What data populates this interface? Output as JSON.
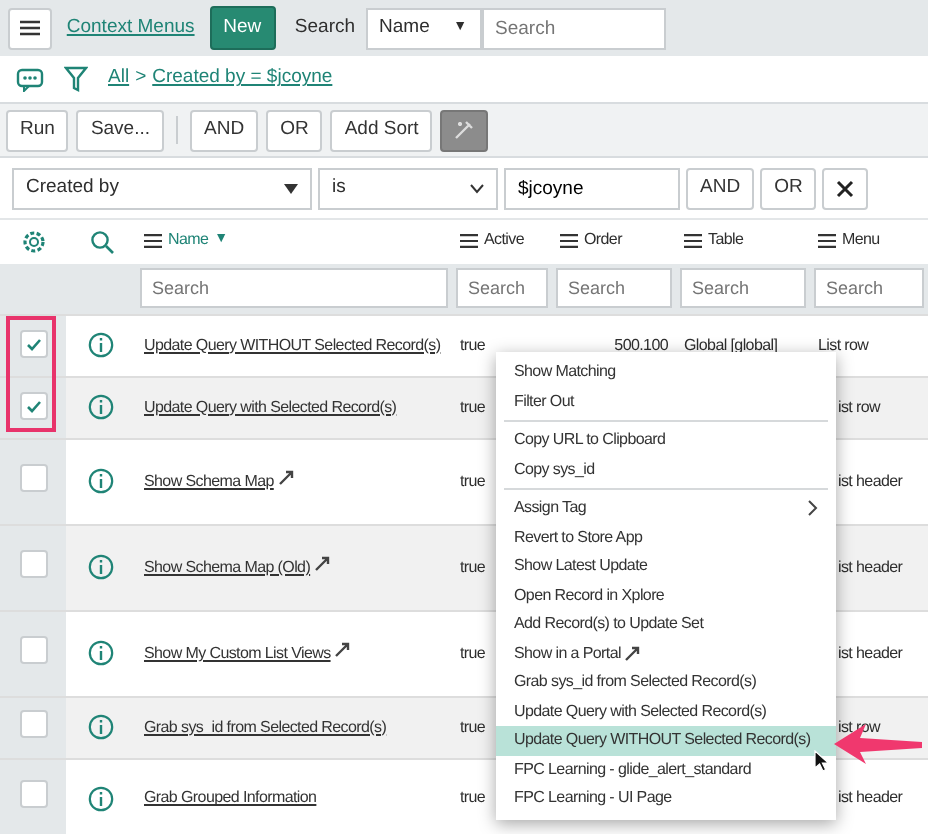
{
  "header": {
    "title": "Context Menus",
    "new_button": "New",
    "search_label": "Search",
    "search_field": {
      "value": "Name",
      "caret": "▼"
    },
    "search_input": {
      "placeholder": "Search"
    }
  },
  "breadcrumb": [
    {
      "text": "All"
    },
    {
      "text": ">"
    },
    {
      "text": "Created by = $jcoyne"
    }
  ],
  "toolbar": [
    "Run",
    "Save...",
    "AND",
    "OR",
    "Add Sort"
  ],
  "condition": {
    "field": "Created by",
    "operator": "is",
    "value": "$jcoyne",
    "buttons": [
      "AND",
      "OR"
    ]
  },
  "columns": [
    {
      "label": "Name",
      "sorted": true,
      "sort_mark": "▼"
    },
    {
      "label": "Active",
      "sorted": false
    },
    {
      "label": "Order",
      "sorted": false
    },
    {
      "label": "Table",
      "sorted": false
    },
    {
      "label": "Menu",
      "sorted": false
    }
  ],
  "column_search": [
    {
      "placeholder": "Search"
    },
    {
      "placeholder": "Search"
    },
    {
      "placeholder": "Search"
    },
    {
      "placeholder": "Search"
    },
    {
      "placeholder": "Search"
    }
  ],
  "rows": [
    {
      "checked": true,
      "name": "Update Query WITHOUT Selected Record(s)",
      "external": false,
      "active": "true",
      "order": "500.100",
      "table": "Global [global]",
      "menu": "List row"
    },
    {
      "checked": true,
      "name": "Update Query with Selected Record(s)",
      "external": false,
      "active": "true",
      "menu": "ist row"
    },
    {
      "checked": false,
      "name": "Show Schema Map",
      "external": true,
      "active": "true",
      "menu": "ist header"
    },
    {
      "checked": false,
      "name": "Show Schema Map (Old)",
      "external": true,
      "active": "true",
      "menu": "ist header"
    },
    {
      "checked": false,
      "name": "Show My Custom List Views",
      "external": true,
      "active": "true",
      "menu": "ist header"
    },
    {
      "checked": false,
      "name": "Grab sys_id from Selected Record(s)",
      "external": false,
      "active": "true",
      "menu": "ist row"
    },
    {
      "checked": false,
      "name": "Grab Grouped Information",
      "external": false,
      "active": "true",
      "menu": "ist header"
    }
  ],
  "context_menu": [
    [
      {
        "label": "Show Matching",
        "selected": false
      },
      {
        "label": "Filter Out",
        "selected": false
      }
    ],
    [
      {
        "label": "Copy URL to Clipboard",
        "selected": false
      },
      {
        "label": "Copy sys_id",
        "selected": false
      }
    ],
    [
      {
        "label": "Assign Tag",
        "selected": false,
        "submenu": true
      },
      {
        "label": "Revert to Store App",
        "selected": false
      },
      {
        "label": "Show Latest Update",
        "selected": false
      },
      {
        "label": "Open Record in Xplore",
        "selected": false
      },
      {
        "label": "Add Record(s) to Update Set",
        "selected": false
      },
      {
        "label": "Show in a Portal",
        "selected": false,
        "external": true
      },
      {
        "label": "Grab sys_id from Selected Record(s)",
        "selected": false
      },
      {
        "label": "Update Query with Selected Record(s)",
        "selected": false
      },
      {
        "label": "Update Query WITHOUT Selected Record(s)",
        "selected": true
      },
      {
        "label": "FPC Learning - glide_alert_standard",
        "selected": false
      },
      {
        "label": "FPC Learning - UI Page",
        "selected": false
      }
    ]
  ]
}
